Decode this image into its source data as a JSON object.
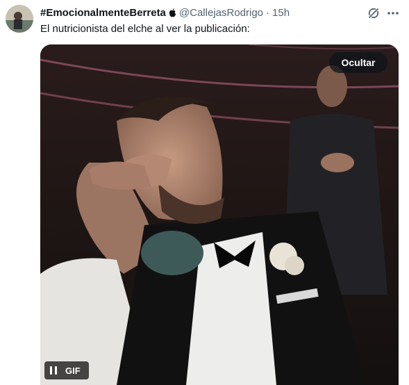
{
  "tweet": {
    "display_name": "#EmocionalmenteBerreta",
    "badge_icon": "apple-icon",
    "handle": "@CallejasRodrigo",
    "separator": "·",
    "time": "15h",
    "text": "El nutricionista del elche al ver la publicación:",
    "grok_icon": "grok-icon",
    "more_icon": "more-horizontal-icon"
  },
  "media": {
    "hide_label": "Ocultar",
    "gif_label": "GIF",
    "pause_icon": "pause-icon"
  },
  "colors": {
    "text_primary": "#0f1419",
    "text_secondary": "#536471",
    "overlay": "#0f1419"
  }
}
